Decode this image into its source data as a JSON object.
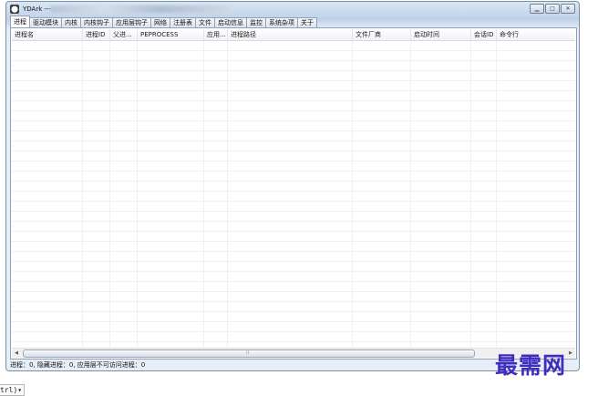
{
  "window": {
    "title": "YDArk ---",
    "icon": "app-icon",
    "controls": [
      "minimize",
      "maximize",
      "close"
    ]
  },
  "tabs": [
    {
      "label": "进程",
      "active": true
    },
    {
      "label": "驱动模块"
    },
    {
      "label": "内核"
    },
    {
      "label": "内核钩子"
    },
    {
      "label": "应用层钩子"
    },
    {
      "label": "网络"
    },
    {
      "label": "注册表"
    },
    {
      "label": "文件"
    },
    {
      "label": "启动信息"
    },
    {
      "label": "监控"
    },
    {
      "label": "系统杂项"
    },
    {
      "label": "关于"
    }
  ],
  "table": {
    "columns": [
      "进程名",
      "进程ID",
      "父进...",
      "PEPROCESS",
      "应用...",
      "进程路径",
      "文件厂商",
      "启动时间",
      "会话ID",
      "命令行"
    ],
    "rows": []
  },
  "status": {
    "text": "进程：0, 隐藏进程：0, 应用层不可访问进程：0"
  },
  "watermark": "最需网",
  "bottom_fragment": "trl)▾",
  "colors": {
    "window_frame": "#7d8fa8",
    "title_gradient": "#c4d6eb",
    "watermark": "#3f2dc0"
  }
}
